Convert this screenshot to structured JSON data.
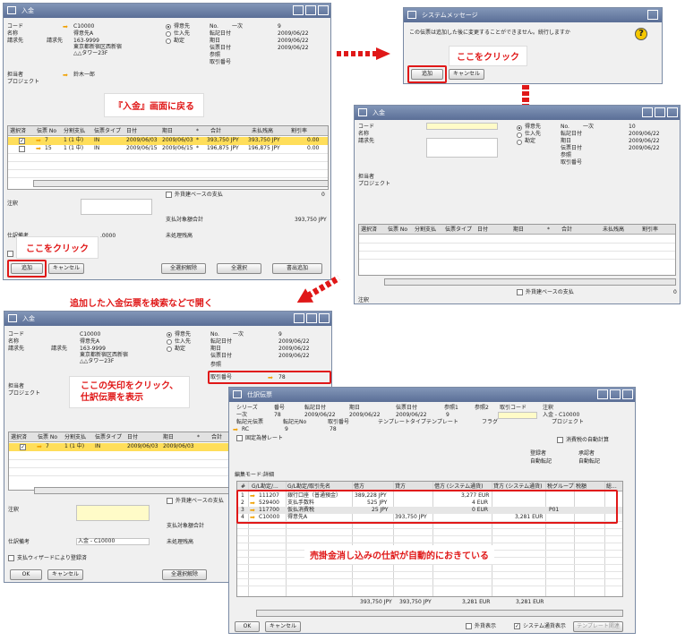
{
  "common": {
    "f_code": "コード",
    "f_name": "名称",
    "f_billto": "請求先",
    "f_rep": "担当者",
    "f_project": "プロジェクト",
    "f_note": "注釈",
    "r_customer": "得意先",
    "r_vendor": "仕入先",
    "r_account": "勘定",
    "f_no": "No.",
    "f_posting": "転記日付",
    "f_due": "期日",
    "f_docdate": "伝票日付",
    "f_ref": "参照",
    "f_transno": "取引番号",
    "series": "一次",
    "col_select": "選択済",
    "col_docno": "伝票 No",
    "col_install": "分割支払",
    "col_doctype": "伝票タイプ",
    "col_date": "日付",
    "col_due": "期日",
    "col_star": "*",
    "col_total": "合計",
    "col_unpaid": "未払残高",
    "col_discount": "割引率",
    "chk_foreign": "外貨建ベースの支払",
    "pay_total": "支払対象額合計",
    "unapplied": "未処理残高",
    "journal_memo": "仕訳備考",
    "wizard": "支払ウィザードにより登録済",
    "btn_add": "追加",
    "btn_cancel": "キャンセル",
    "btn_ok": "OK",
    "btn_deselect": "全選択解除",
    "btn_selectall": "全選択",
    "btn_adddoc": "書出追加"
  },
  "w1": {
    "title": "入金",
    "code": "C10000",
    "name": "得意先A",
    "billto": "請求先",
    "addr1": "163-9999",
    "addr2": "東京都新宿区西新宿",
    "addr3": "△△タワー23F",
    "rep": "鈴木一郎",
    "no": "9",
    "posting": "2009/06/22",
    "due": "2009/06/22",
    "docdate": "2009/06/22",
    "rows": [
      [
        "7",
        "1 (1 中)",
        "IN",
        "2009/06/03",
        "2009/06/03",
        "*",
        "393,750 JPY",
        "393,750 JPY",
        "0.00"
      ],
      [
        "15",
        "1 (1 中)",
        "IN",
        "2009/06/15",
        "2009/06/15",
        "*",
        "196,875 JPY",
        "196,875 JPY",
        "0.00"
      ]
    ],
    "zero": "0",
    "total": "393,750 JPY",
    "memo": ".0000"
  },
  "w2": {
    "title": "システムメッセージ",
    "message": "この伝票は追加した後に変更することができません。続行しますか",
    "add": "追加",
    "cancel": "キャンセル"
  },
  "w3": {
    "title": "入金",
    "no": "10",
    "posting": "2009/06/22",
    "due": "2009/06/22",
    "docdate": "2009/06/22",
    "zero": "0"
  },
  "w4": {
    "title": "入金",
    "code": "C10000",
    "name": "得意先A",
    "billto": "請求先",
    "addr1": "163-9999",
    "addr2": "東京都新宿区西新宿",
    "addr3": "△△タワー23F",
    "no": "9",
    "posting": "2009/06/22",
    "due": "2009/06/22",
    "docdate": "2009/06/22",
    "transno": "78",
    "row": [
      "7",
      "1 (1 中)",
      "IN",
      "2009/06/03",
      "2009/06/03"
    ],
    "memo_value": "入金 - C10000"
  },
  "w5": {
    "title": "仕訳伝票",
    "h_series": "シリーズ",
    "h_no": "番号",
    "h_posting": "転記日付",
    "h_due": "期日",
    "h_docdate": "伝票日付",
    "h_ref1": "参照1",
    "h_ref2": "参照2",
    "h_transcode": "取引コード",
    "h_remarks": "注釈",
    "series": "一次",
    "no": "78",
    "posting": "2009/06/22",
    "due": "2009/06/22",
    "docdate": "2009/06/22",
    "ref1": "9",
    "remarks": "入金 - C10000",
    "h_origin": "転記元伝票",
    "h_originno": "転記元No",
    "h_transno": "取引番号",
    "h_template_type": "テンプレートタイプ",
    "h_template": "テンプレート",
    "h_indicator": "フラグ",
    "h_project": "プロジェクト",
    "origin": "RC",
    "originno": "9",
    "transno": "78",
    "fixed_rate": "固定為替レート",
    "reversal": "消費税の自動計算",
    "h_approval1": "登録者",
    "h_approval2": "承認者",
    "approval1": "自動転記",
    "approval2": "自動転記",
    "edit_mode": "編集モード:詳細",
    "cols": [
      "#",
      "G/L勘定/...",
      "G/L勘定/取引先名",
      "借方",
      "貸方",
      "借方 (システム通貨)",
      "貸方 (システム通貨)",
      "税グループ",
      "税額",
      "総..."
    ],
    "rows": [
      [
        "1",
        "111207",
        "銀行口座（普通預金）",
        "389,228 JPY",
        "",
        "3,277 EUR",
        "",
        "",
        "",
        ""
      ],
      [
        "2",
        "529400",
        "支払手数料",
        "525 JPY",
        "",
        "4 EUR",
        "",
        "",
        "",
        ""
      ],
      [
        "3",
        "117700",
        "仮払消費税",
        "25 JPY",
        "",
        "0 EUR",
        "",
        "P01",
        "",
        ""
      ],
      [
        "4",
        "C10000",
        "得意先A",
        "",
        "393,750 JPY",
        "",
        "3,281 EUR",
        "",
        "",
        ""
      ]
    ],
    "tot": [
      "393,750 JPY",
      "393,750 JPY",
      "3,281 EUR",
      "3,281 EUR"
    ],
    "ok": "OK",
    "cancel": "キャンセル",
    "chk1": "外貨表示",
    "chk2": "システム通貨表示",
    "tmpl_btn": "テンプレート関連"
  },
  "callouts": {
    "back": "『入金』画面に戻る",
    "click_add": "ここをクリック",
    "click_msg": "ここをクリック",
    "search": "追加した入金伝票を検索などで開く",
    "arrow": "ここの矢印をクリック、\n仕訳伝票を表示",
    "auto": "売掛金消し込みの仕訳が自動的におきている"
  },
  "colors": {
    "accent": "#e01818",
    "titlebar": "#5a6e96",
    "highlight": "#ffde5a"
  }
}
